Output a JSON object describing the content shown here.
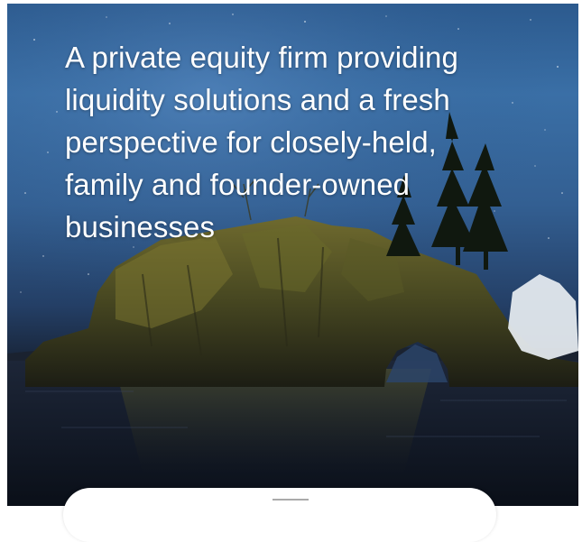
{
  "hero": {
    "headline": "A private equity firm providing liquidity solutions and a fresh perspective for closely-held, family and founder-owned businesses",
    "background_image": "night-sky-rock-arch-lake-icon"
  },
  "colors": {
    "sky_top": "#2c5a8e",
    "sky_mid": "#3a6fa6",
    "water": "#0e141f",
    "headline_text": "#ffffff",
    "card_background": "#ffffff"
  }
}
